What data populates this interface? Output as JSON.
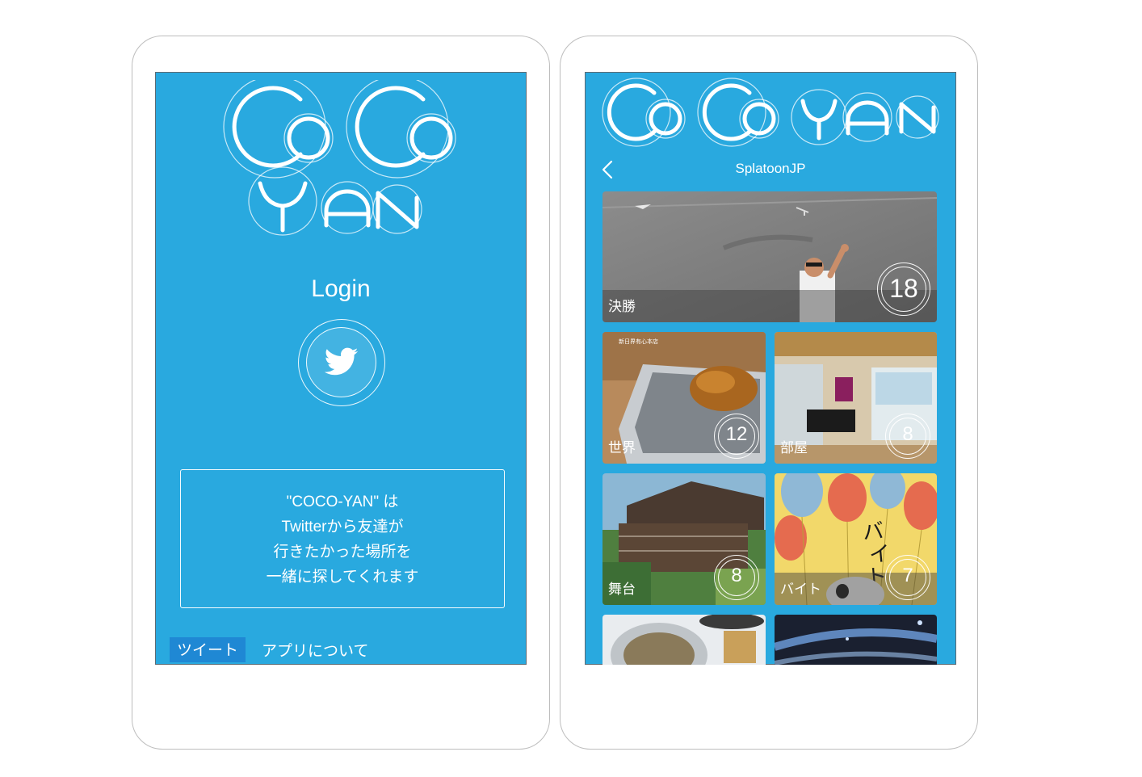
{
  "login_screen": {
    "logo_text": "CoCoYAN",
    "title": "Login",
    "twitter_button_icon": "twitter-bird-icon",
    "description_lines": [
      "\"COCO-YAN\" は",
      "Twitterから友達が",
      "行きたかった場所を",
      "一緒に探してくれます"
    ],
    "nav": {
      "tweet_label": "ツイート",
      "about_label": "アプリについて"
    }
  },
  "list_screen": {
    "logo_text": "CoCoYAN",
    "header": {
      "back_icon": "chevron-left-icon",
      "title": "SplatoonJP"
    },
    "cards": [
      {
        "label": "決勝",
        "count": "18"
      },
      {
        "label": "世界",
        "count": "12"
      },
      {
        "label": "部屋",
        "count": "8"
      },
      {
        "label": "舞台",
        "count": "8"
      },
      {
        "label": "バイト",
        "count": "7"
      },
      {
        "label": "",
        "count": ""
      },
      {
        "label": "",
        "count": ""
      }
    ]
  },
  "colors": {
    "screen_bg": "#29a9df",
    "tweet_tab_bg": "#1f88d4",
    "text": "#ffffff"
  }
}
